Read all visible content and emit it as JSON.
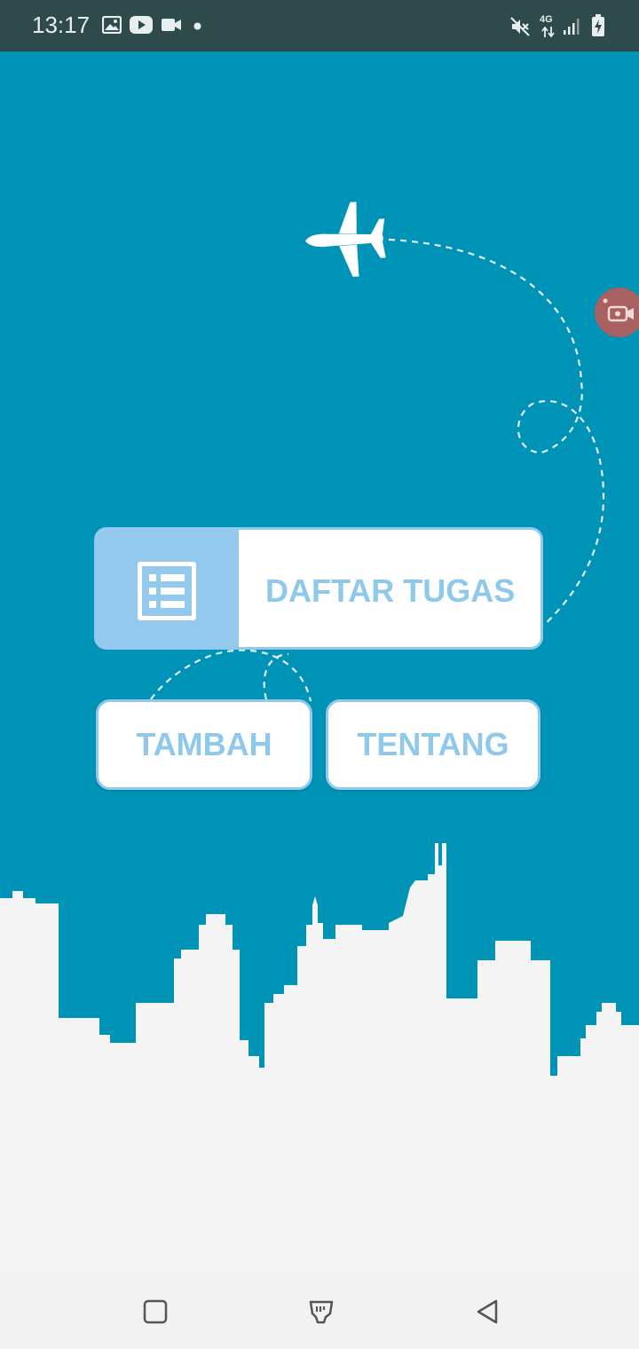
{
  "status_bar": {
    "time": "13:17",
    "left_icons": [
      "gallery-icon",
      "youtube-icon",
      "video-camera-icon",
      "notification-dot-icon"
    ],
    "right_icons": [
      "mute-icon",
      "4g-data-icon",
      "signal-icon",
      "battery-charging-icon"
    ],
    "network_label": "4G"
  },
  "main": {
    "daftar_button": {
      "label": "DAFTAR TUGAS",
      "icon": "list-icon"
    },
    "tambah_button": {
      "label": "TAMBAH"
    },
    "tentang_button": {
      "label": "TENTANG"
    },
    "floating_button": {
      "icon": "screen-record-icon"
    },
    "illustration": {
      "airplane": "airplane-icon",
      "skyline": "city-skyline"
    }
  },
  "nav_bar": {
    "buttons": [
      "recent-apps-icon",
      "home-icon",
      "back-icon"
    ]
  },
  "colors": {
    "background": "#0093b8",
    "button_accent": "#92c9ec",
    "status_bar": "#2f4a4b",
    "skyline": "#f4f4f4"
  }
}
